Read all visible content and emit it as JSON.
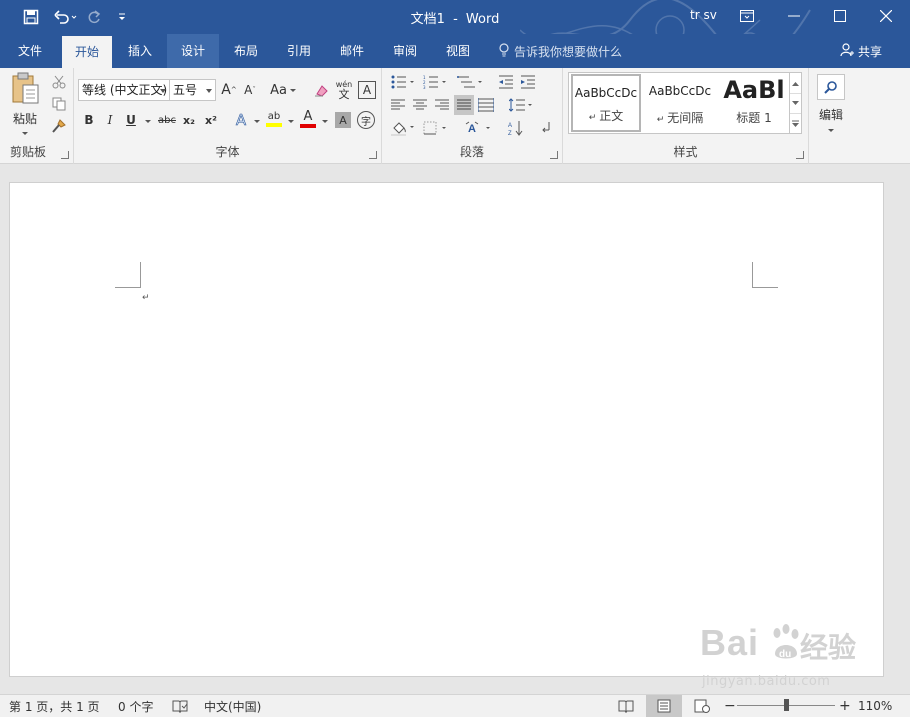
{
  "app": {
    "doc_name": "文档1",
    "separator": "-",
    "app_name": "Word",
    "user": "tr sv"
  },
  "colors": {
    "brand": "#2b579a",
    "ribbon_bg": "#f3f3f3",
    "highlight_yellow": "#ffff00",
    "font_color_red": "#e00000"
  },
  "quick_access": {
    "icons": [
      "save-icon",
      "undo-icon",
      "redo-icon",
      "customize-qat-icon"
    ]
  },
  "tabs": [
    {
      "label": "文件",
      "state": "normal"
    },
    {
      "label": "开始",
      "state": "active"
    },
    {
      "label": "插入",
      "state": "normal"
    },
    {
      "label": "设计",
      "state": "hover"
    },
    {
      "label": "布局",
      "state": "normal"
    },
    {
      "label": "引用",
      "state": "normal"
    },
    {
      "label": "邮件",
      "state": "normal"
    },
    {
      "label": "审阅",
      "state": "normal"
    },
    {
      "label": "视图",
      "state": "normal"
    }
  ],
  "tell_me": "告诉我你想要做什么",
  "share": "共享",
  "ribbon": {
    "clipboard": {
      "label": "剪贴板",
      "paste": "粘贴"
    },
    "font": {
      "label": "字体",
      "font_name": "等线 (中文正文)",
      "font_size": "五号",
      "change_case": "Aa",
      "phonetic": "wén",
      "phonetic_char": "文",
      "char_border": "A",
      "bold": "B",
      "italic": "I",
      "underline": "U",
      "strikethrough": "abc",
      "subscript": "x₂",
      "superscript": "x²",
      "text_effects": "A",
      "highlight": "ab",
      "font_color": "A",
      "char_shading": "A",
      "enclose_char": "字"
    },
    "paragraph": {
      "label": "段落"
    },
    "styles": {
      "label": "样式",
      "items": [
        {
          "sample": "AaBbCcDc",
          "name": "正文"
        },
        {
          "sample": "AaBbCcDc",
          "name": "无间隔"
        },
        {
          "sample": "AaBl",
          "name": "标题 1"
        }
      ]
    },
    "editing": {
      "label": "编辑"
    }
  },
  "status": {
    "page": "第 1 页，共 1 页",
    "words": "0 个字",
    "language": "中文(中国)",
    "zoom": "110%",
    "zoom_minus": "−",
    "zoom_plus": "+"
  },
  "watermark": {
    "brand": "Bai",
    "brand_suffix": "经验",
    "url": "jingyan.baidu.com"
  }
}
